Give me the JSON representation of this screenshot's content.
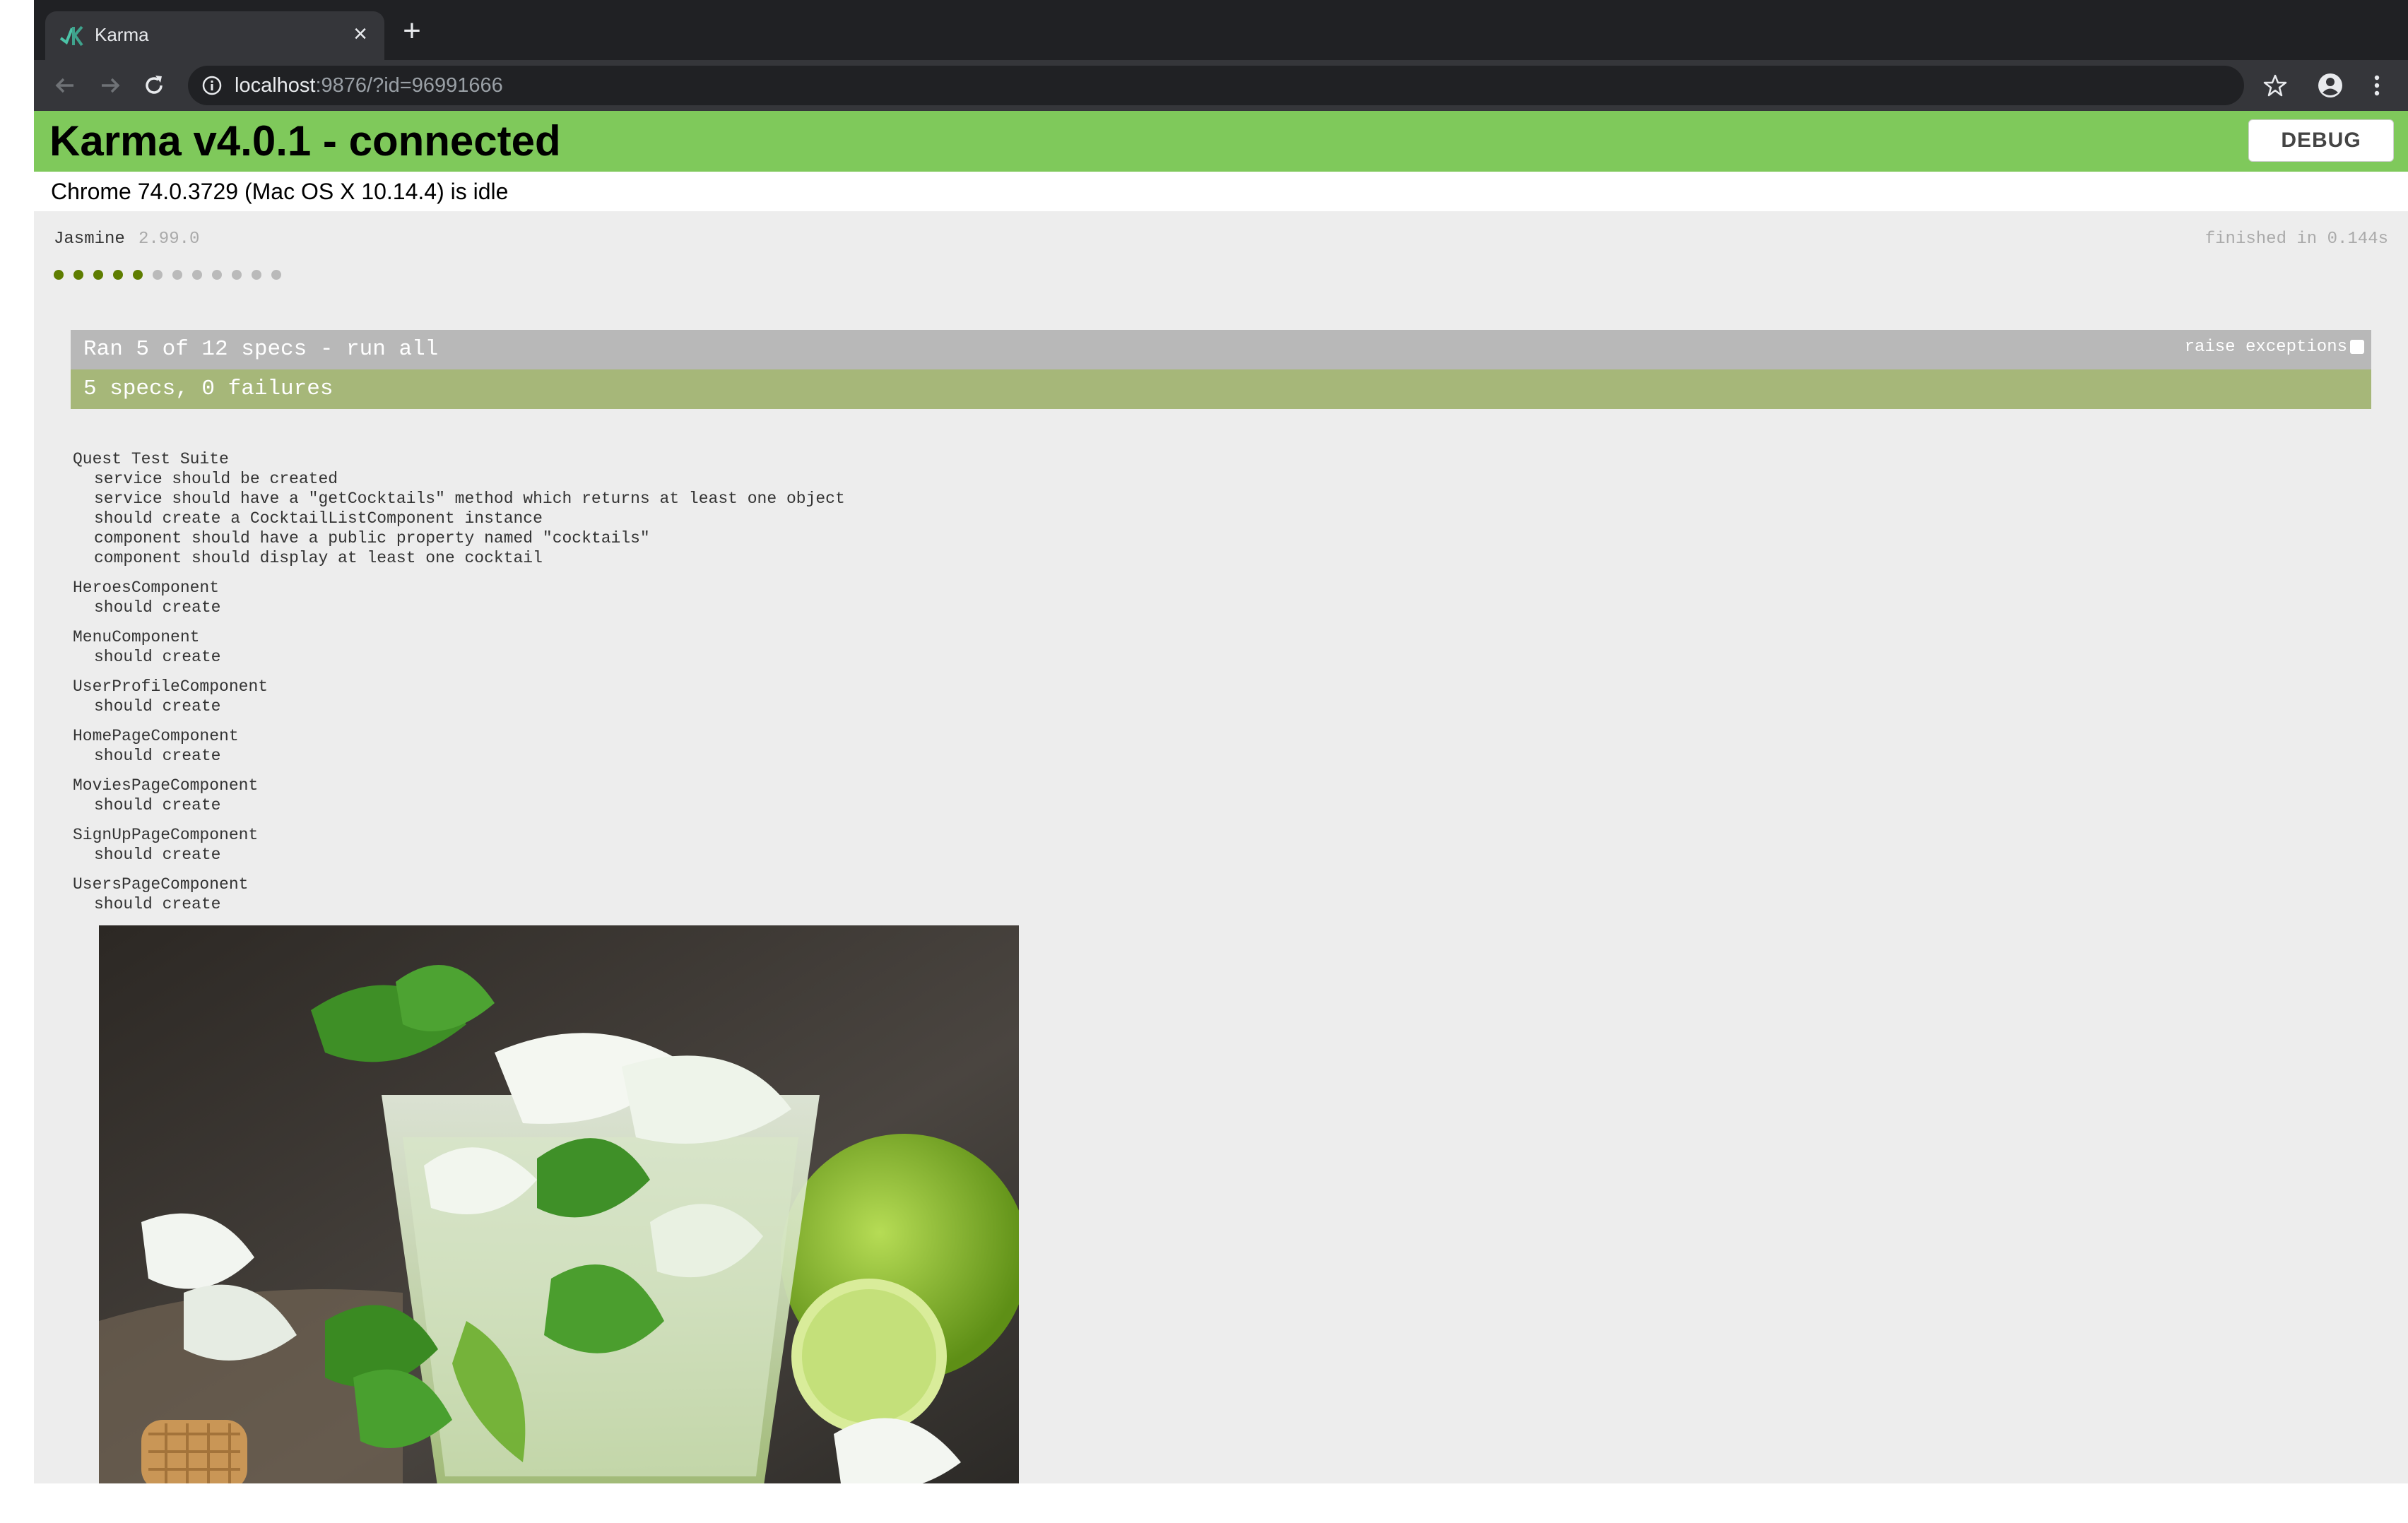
{
  "browser": {
    "tab_title": "Karma",
    "tab_close": "×",
    "new_tab": "+",
    "url_host": "localhost",
    "url_rest": ":9876/?id=96991666"
  },
  "karma": {
    "title": "Karma v4.0.1 - connected",
    "debug_label": "DEBUG",
    "browser_status": "Chrome 74.0.3729 (Mac OS X 10.14.4) is idle",
    "banner_color": "#7fc95b"
  },
  "jasmine": {
    "name": "Jasmine",
    "version": "2.99.0",
    "duration": "finished in 0.144s",
    "symbols": [
      "passed",
      "passed",
      "passed",
      "passed",
      "passed",
      "skipped",
      "skipped",
      "skipped",
      "skipped",
      "skipped",
      "skipped",
      "skipped"
    ],
    "summary": "Ran 5 of 12 specs - run all",
    "raise_exceptions": "raise exceptions",
    "result": "5 specs, 0 failures"
  },
  "suites": [
    {
      "name": "Quest Test Suite",
      "specs": [
        "service should be created",
        "service should have a \"getCocktails\" method which returns at least one object",
        "should create a CocktailListComponent instance",
        "component should have a public property named \"cocktails\"",
        "component should display at least one cocktail"
      ]
    },
    {
      "name": "HeroesComponent",
      "specs": [
        "should create"
      ]
    },
    {
      "name": "MenuComponent",
      "specs": [
        "should create"
      ]
    },
    {
      "name": "UserProfileComponent",
      "specs": [
        "should create"
      ]
    },
    {
      "name": "HomePageComponent",
      "specs": [
        "should create"
      ]
    },
    {
      "name": "MoviesPageComponent",
      "specs": [
        "should create"
      ]
    },
    {
      "name": "SignUpPageComponent",
      "specs": [
        "should create"
      ]
    },
    {
      "name": "UsersPageComponent",
      "specs": [
        "should create"
      ]
    }
  ],
  "icons": {
    "back": "back-arrow-icon",
    "forward": "forward-arrow-icon",
    "reload": "reload-icon",
    "info": "info-icon",
    "bookmark": "star-icon",
    "profile": "account-icon",
    "menu": "kebab-menu-icon"
  }
}
